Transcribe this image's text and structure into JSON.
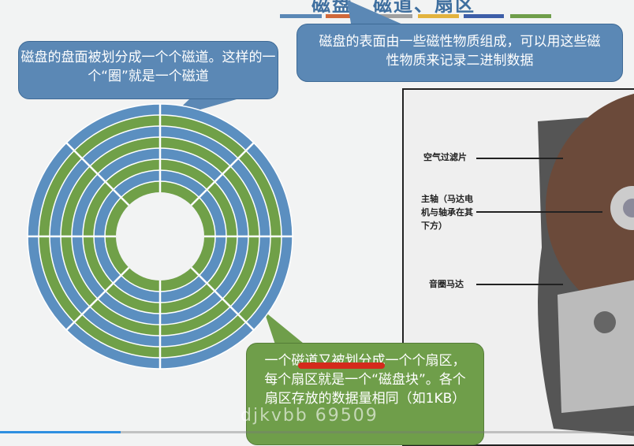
{
  "slide": {
    "title": "磁盘、磁道、扇区",
    "accent_bars": [
      "#5b88b5",
      "#d0683a",
      "#a0a0a0",
      "#e2b33e",
      "#3d5ea8",
      "#6f9e4a"
    ],
    "callout_track": "磁盘的盘面被划分成一个个磁道。这样的一个“圈”就是一个磁道",
    "callout_surface": "磁盘的表面由一些磁性物质组成，可以用这些磁性物质来记录二进制数据",
    "callout_sector": "一个磁道又被划分成一个个扇区，每个扇区就是一个“磁盘块”。各个扇区存放的数据量相同（如1KB）",
    "photo_labels": {
      "air_filter": "空气过滤片",
      "spindle": "主轴（马达电机与轴承在其下方）",
      "voice_coil": "音圈马达"
    },
    "disk_colors": {
      "track_a": "#5b8fc0",
      "track_b": "#70a048"
    }
  },
  "player": {
    "progress_fraction": 0.19,
    "watermark": "djkvbb 69509"
  }
}
